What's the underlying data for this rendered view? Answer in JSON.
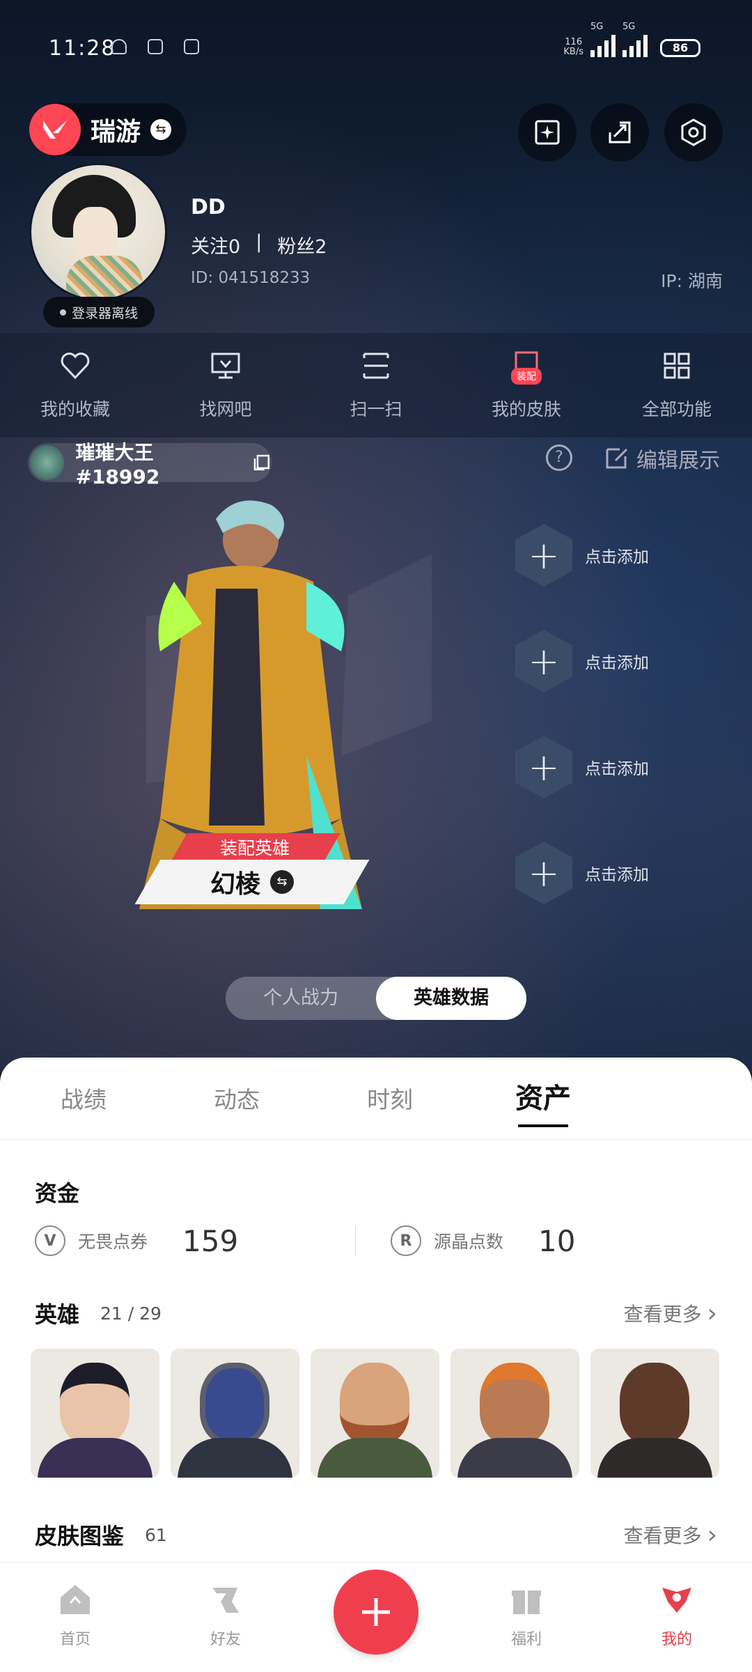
{
  "status_bar": {
    "time": "11:28",
    "net_speed": "116",
    "net_unit": "KB/s",
    "sim1": "5G",
    "sim2": "5G",
    "battery": "86"
  },
  "header": {
    "brand_name": "瑞游"
  },
  "profile": {
    "username": "DD",
    "following": "关注0",
    "separator": "|",
    "followers": "粉丝2",
    "user_id": "ID: 041518233",
    "ip": "IP: 湖南",
    "online_status": "登录器离线"
  },
  "quick_actions": [
    {
      "label": "我的收藏",
      "icon": "heart-icon"
    },
    {
      "label": "找网吧",
      "icon": "monitor-icon"
    },
    {
      "label": "扫一扫",
      "icon": "scan-icon"
    },
    {
      "label": "我的皮肤",
      "icon": "skin-icon",
      "badge": "装配"
    },
    {
      "label": "全部功能",
      "icon": "grid-icon"
    }
  ],
  "player_card": {
    "riot_id": "璀璀大王 #18992",
    "edit_label": "编辑展示",
    "help_symbol": "?",
    "agent_tag": "装配英雄",
    "agent_name": "幻棱",
    "slots": [
      {
        "label": "点击添加"
      },
      {
        "label": "点击添加"
      },
      {
        "label": "点击添加"
      },
      {
        "label": "点击添加"
      }
    ],
    "segment": [
      "个人战力",
      "英雄数据"
    ],
    "segment_active": 1
  },
  "tabs": [
    "战绩",
    "动态",
    "时刻",
    "资产"
  ],
  "active_tab": 3,
  "assets": {
    "funds_title": "资金",
    "funds": [
      {
        "label": "无畏点券",
        "value": "159",
        "icon_letter": "V"
      },
      {
        "label": "源晶点数",
        "value": "10",
        "icon_letter": "R"
      }
    ],
    "heroes_title": "英雄",
    "heroes_count": "21 / 29",
    "see_more": "查看更多",
    "skins_title": "皮肤图鉴",
    "skins_count": "61"
  },
  "bottom_nav": [
    {
      "label": "首页",
      "icon": "home-icon"
    },
    {
      "label": "好友",
      "icon": "friends-icon"
    },
    {
      "label": "",
      "icon": "plus-icon"
    },
    {
      "label": "福利",
      "icon": "gift-icon"
    },
    {
      "label": "我的",
      "icon": "profile-icon"
    }
  ],
  "colors": {
    "accent": "#ff4655",
    "background": "#0f1a2b",
    "sheet": "#ffffff"
  }
}
